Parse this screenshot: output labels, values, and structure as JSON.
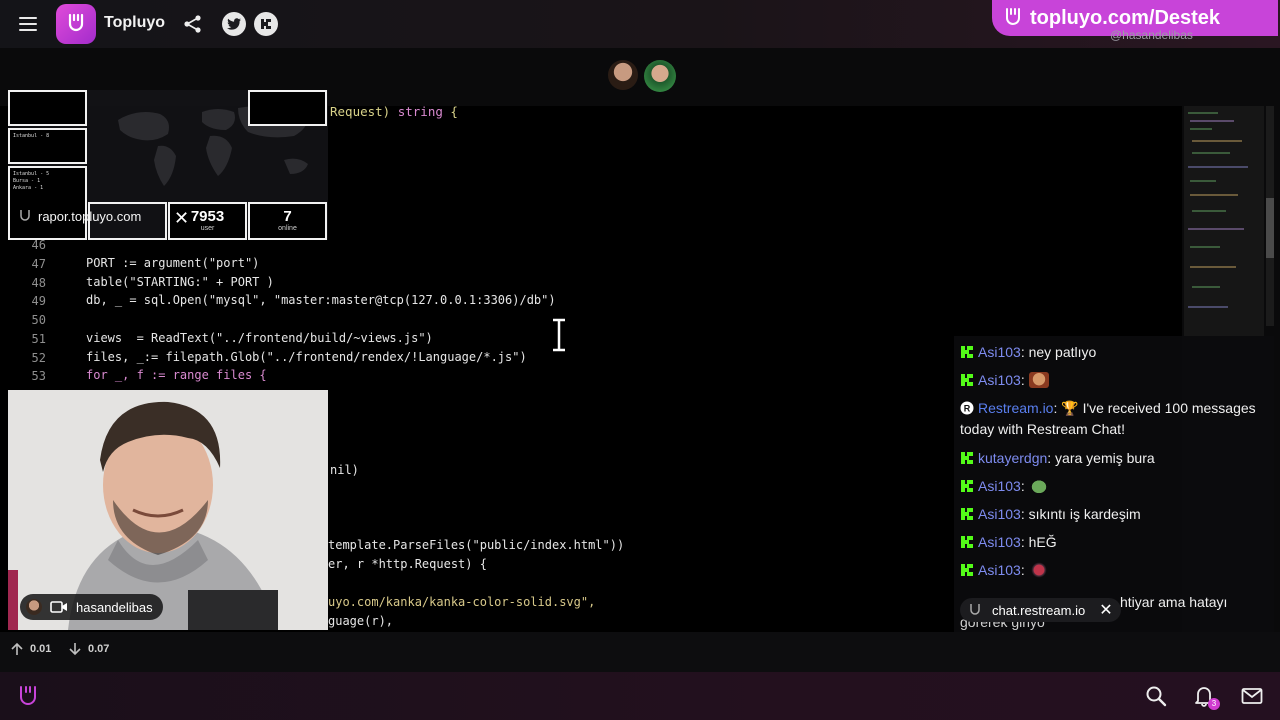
{
  "header": {
    "app_title": "Topluyo",
    "promo_text": "topluyo.com/Destek",
    "promo_sub": "@hasandelibas"
  },
  "code": {
    "top_line": {
      "pre": "Request) ",
      "kw": "string",
      "post": " {"
    },
    "lines": [
      {
        "n": "46",
        "text": ""
      },
      {
        "n": "47",
        "text": "PORT := argument(\"port\")"
      },
      {
        "n": "48",
        "text": "table(\"STARTING:\" + PORT )"
      },
      {
        "n": "49",
        "text": "db, _ = sql.Open(\"mysql\", \"master:master@tcp(127.0.0.1:3306)/db\")"
      },
      {
        "n": "50",
        "text": ""
      },
      {
        "n": "51",
        "text": "views  = ReadText(\"../frontend/build/~views.js\")"
      },
      {
        "n": "52",
        "text": "files, _:= filepath.Glob(\"../frontend/rendex/!Language/*.js\")"
      },
      {
        "n": "53",
        "text": "for _, f := range files {"
      }
    ],
    "fragments": [
      "nil)",
      "template.ParseFiles(\"public/index.html\"))",
      "er, r *http.Request) {",
      "uyo.com/kanka/kanka-color-solid.svg\",",
      "guage(r),"
    ]
  },
  "report": {
    "url": "rapor.topluyo.com",
    "box1_text": "Istanbul - 8",
    "box2_text": "Istanbul - 5\nBursa - 1\nAnkara - 1",
    "users_value": "7953",
    "users_label": "user",
    "online_value": "7",
    "online_label": "online"
  },
  "webcam": {
    "name": "hasandelibas"
  },
  "chat": {
    "messages": [
      {
        "user": "Asi103",
        "text": " ney patlıyo",
        "platform": "kick"
      },
      {
        "user": "Asi103",
        "text": "",
        "platform": "kick",
        "emote": "face-emote"
      },
      {
        "user": "Restream.io",
        "text": " 🏆 I've received 100 messages today with Restream Chat!",
        "platform": "restream"
      },
      {
        "user": "kutayerdgn",
        "text": " yara yemiş bura",
        "platform": "kick"
      },
      {
        "user": "Asi103",
        "text": "",
        "platform": "kick",
        "emote": "frog-emote"
      },
      {
        "user": "Asi103",
        "text": " sıkıntı iş kardeşim",
        "platform": "kick"
      },
      {
        "user": "Asi103",
        "text": " hEĞ",
        "platform": "kick"
      },
      {
        "user": "Asi103",
        "text": "",
        "platform": "kick",
        "emote": "bug-emote"
      }
    ],
    "partial_message": "htiyar ama hatayı",
    "partial_message_2": "görerek giriyo",
    "source_label": "chat.restream.io"
  },
  "stats": {
    "upload": "0.01",
    "download": "0.07"
  },
  "nav": {
    "notification_count": "3"
  },
  "colors": {
    "brand": "#c844d9",
    "kick_green": "#53fc18",
    "chat_user": "#7e8cf0"
  }
}
